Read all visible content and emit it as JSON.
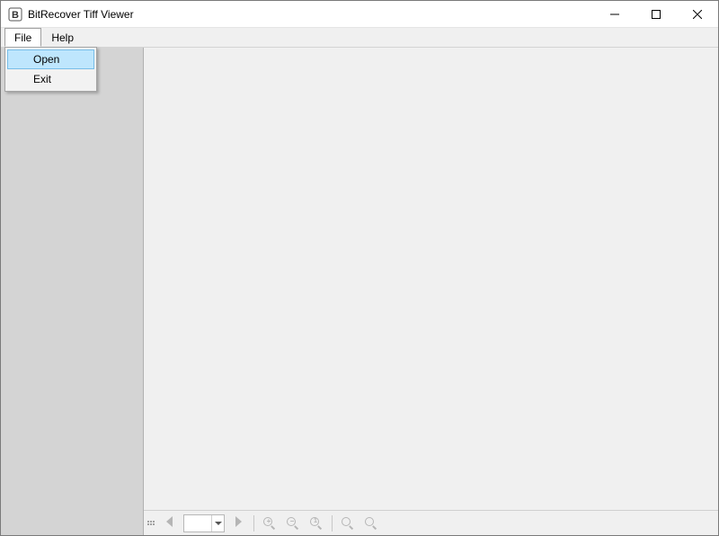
{
  "title": "BitRecover Tiff Viewer",
  "menus": {
    "file": "File",
    "help": "Help"
  },
  "file_menu": {
    "open": "Open",
    "exit": "Exit"
  },
  "toolbar": {
    "page_value": "",
    "icons": {
      "prev": "prev-page-icon",
      "next": "next-page-icon",
      "zoom_in": "zoom-in-icon",
      "zoom_out": "zoom-out-icon",
      "zoom_actual": "zoom-actual-icon",
      "zoom_fit_width": "zoom-fit-width-icon",
      "zoom_fit_page": "zoom-fit-page-icon"
    }
  }
}
